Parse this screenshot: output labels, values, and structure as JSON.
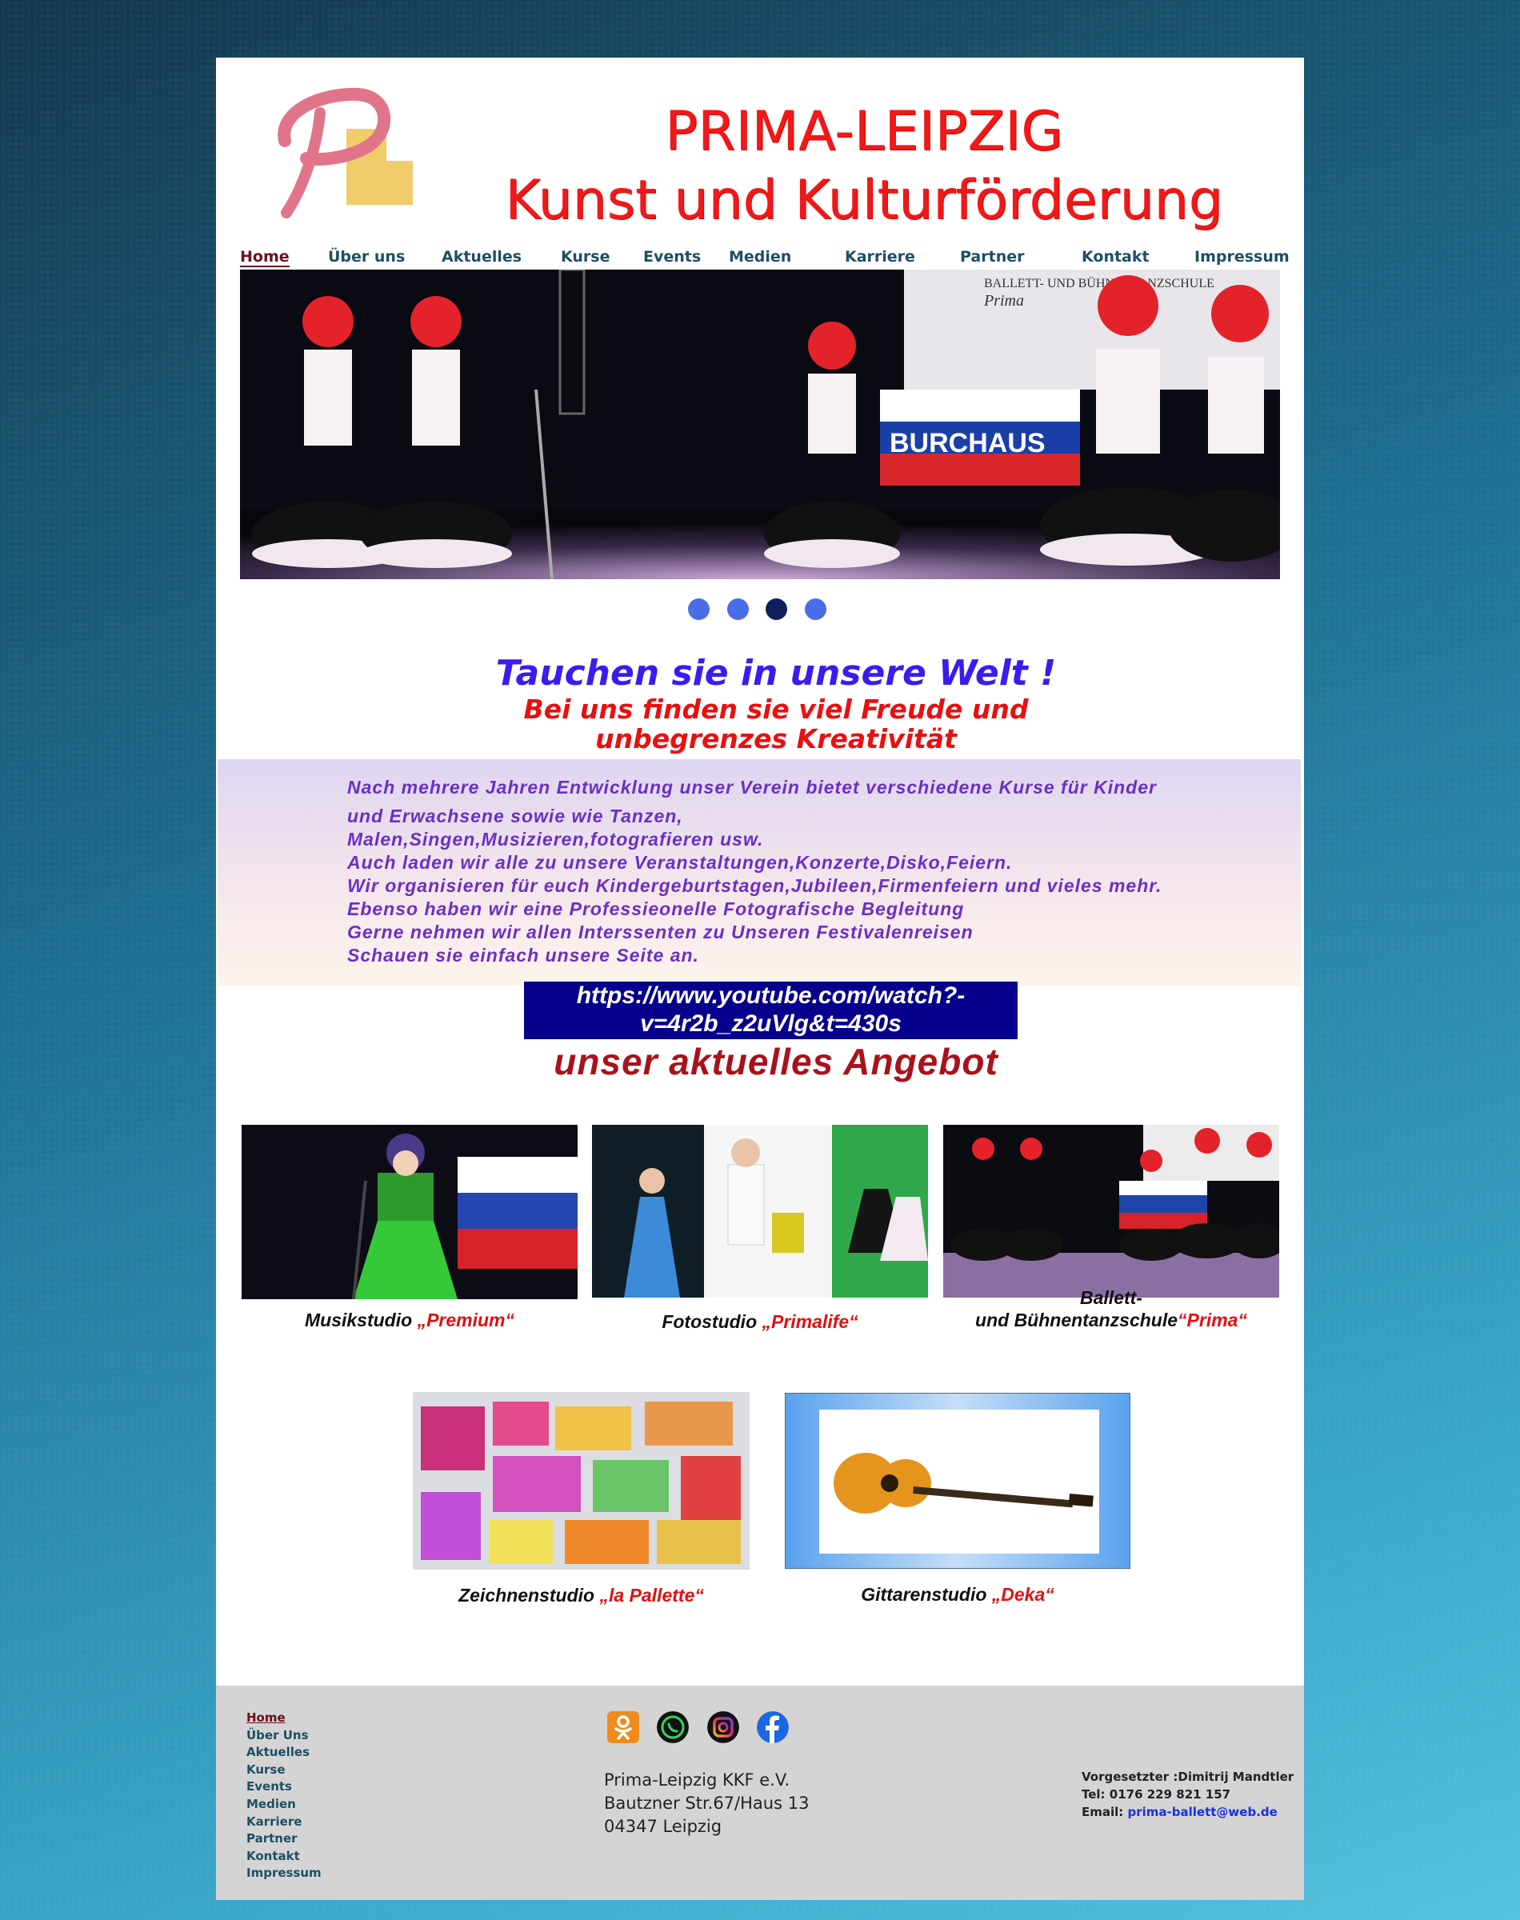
{
  "header": {
    "title_line1": "PRIMA-LEIPZIG",
    "title_line2": "Kunst und Kulturförderung"
  },
  "nav": {
    "items": [
      "Home",
      "Über uns",
      "Aktuelles",
      "Kurse",
      "Events",
      "Medien",
      "Karriere",
      "Partner",
      "Kontakt",
      "Impressum"
    ],
    "active": "Home"
  },
  "slider": {
    "dots": 4,
    "active_dot": 3,
    "banner_text": "BURCHAUS",
    "sign_line1": "BALLETT- UND BÜHNENTANZSCHULE",
    "sign_line2": "Prima"
  },
  "tagline": {
    "line1": "Tauchen sie in unsere Welt !",
    "line2": "Bei uns finden sie viel Freude und",
    "line3": "unbegrenzes Kreativität"
  },
  "intro": {
    "lines": [
      "Nach mehrere Jahren Entwicklung unser Verein bietet verschiedene Kurse für Kinder",
      "und Erwachsene sowie wie Tanzen,",
      "Malen,Singen,Musizieren,fotografieren usw.",
      "Auch laden wir alle zu unsere Veranstaltungen,Konzerte,Disko,Feiern.",
      "Wir organisieren für euch Kindergeburtstagen,Jubileen,Firmenfeiern und vieles mehr.",
      "Ebenso haben wir eine  Professieonelle  Fotografische Begleitung",
      "Gerne nehmen wir  allen Interssenten zu Unseren Festivalenreisen",
      "Schauen sie einfach unsere Seite an."
    ]
  },
  "youtube": {
    "line1": "https://www.youtube.com/watch?-",
    "line2": "v=4r2b_z2uVlg&t=430s"
  },
  "offer_heading": "unser aktuelles Angebot",
  "studios": [
    {
      "prefix": "Musikstudio ",
      "name": "„Premium“"
    },
    {
      "prefix": "Fotostudio ",
      "name": "„Primalife“"
    },
    {
      "prefix_line1": "Ballett-",
      "prefix_line2": "und Bühnentanzschule",
      "name": "“Prima“"
    },
    {
      "prefix": "Zeichnenstudio ",
      "name": "„la Pallette“"
    },
    {
      "prefix": "Gittarenstudio ",
      "name": "„Deka“"
    }
  ],
  "footer": {
    "nav": [
      "Home",
      "Über Uns",
      "Aktuelles",
      "Kurse",
      "Events",
      "Medien",
      "Karriere",
      "Partner",
      "Kontakt",
      "Impressum"
    ],
    "social": [
      "odnoklassniki-icon",
      "whatsapp-icon",
      "instagram-icon",
      "facebook-icon"
    ],
    "address": [
      "Prima-Leipzig KKF e.V.",
      "Bautzner Str.67/Haus 13",
      "04347 Leipzig"
    ],
    "contact": {
      "boss": "Vorgesetzter :Dimitrij Mandtler",
      "tel": "Tel: 0176 229 821 157",
      "email_label": "Email: ",
      "email": "prima-ballett@web.de"
    }
  },
  "colors": {
    "title_red": "#f01818",
    "nav_teal": "#1d4f64",
    "tagline_blue": "#3c1bf0",
    "intro_purple": "#6b2fc6",
    "youtube_bg": "#06008c",
    "offer_red": "#a8121c"
  }
}
